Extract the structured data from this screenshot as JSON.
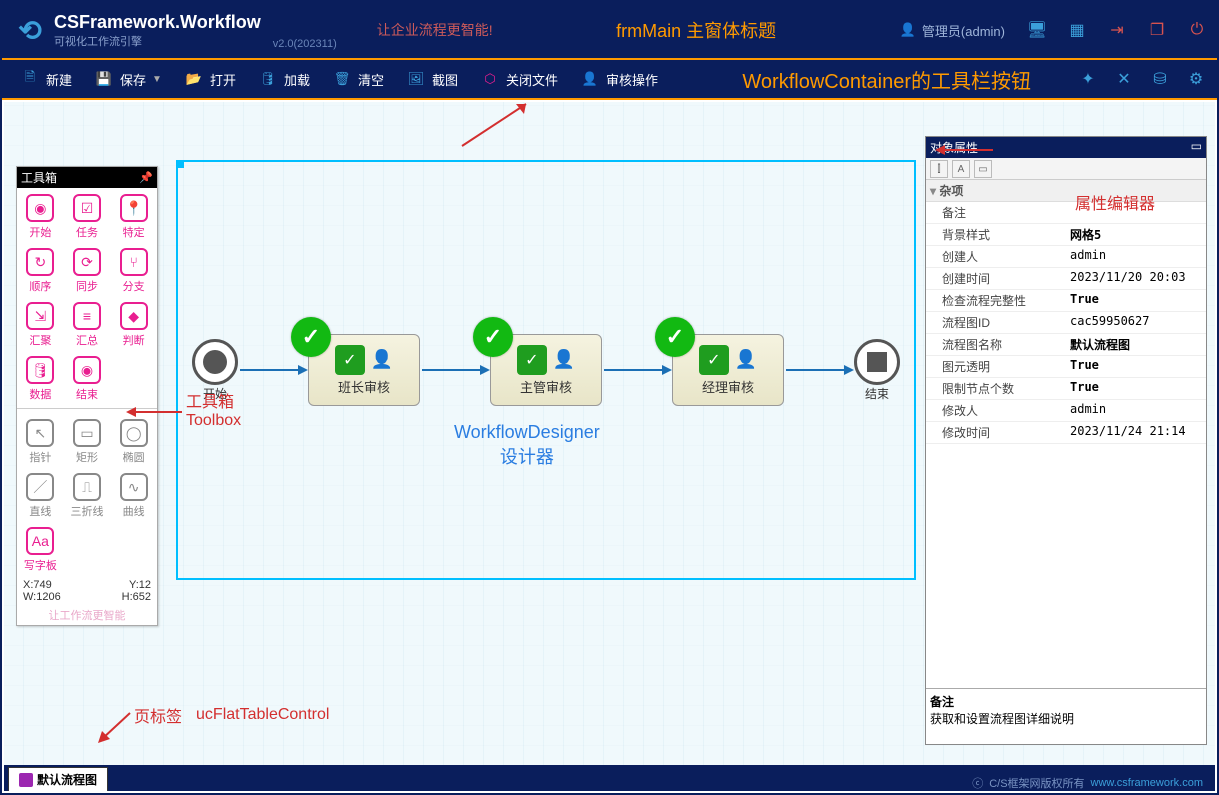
{
  "header": {
    "app_title": "CSFramework.Workflow",
    "app_subtitle": "可视化工作流引擎",
    "version": "v2.0(202311)",
    "slogan": "让企业流程更智能!",
    "window_title": "frmMain 主窗体标题",
    "user_label": "管理员(admin)"
  },
  "toolbar": {
    "new": "新建",
    "save": "保存",
    "open": "打开",
    "load": "加载",
    "clear": "清空",
    "screenshot": "截图",
    "close_file": "关闭文件",
    "audit": "审核操作",
    "caption": "WorkflowContainer的工具栏按钮"
  },
  "toolbox": {
    "title": "工具箱",
    "items_main": [
      {
        "label": "开始"
      },
      {
        "label": "任务"
      },
      {
        "label": "特定"
      },
      {
        "label": "顺序"
      },
      {
        "label": "同步"
      },
      {
        "label": "分支"
      },
      {
        "label": "汇聚"
      },
      {
        "label": "汇总"
      },
      {
        "label": "判断"
      },
      {
        "label": "数据"
      },
      {
        "label": "结束"
      }
    ],
    "items_shapes": [
      {
        "label": "指针",
        "gray": true
      },
      {
        "label": "矩形",
        "gray": true
      },
      {
        "label": "椭圆",
        "gray": true
      },
      {
        "label": "直线",
        "gray": true
      },
      {
        "label": "三折线",
        "gray": true
      },
      {
        "label": "曲线",
        "gray": true
      },
      {
        "label": "写字板"
      }
    ],
    "coords": {
      "x": "X:749",
      "y": "Y:12",
      "w": "W:1206",
      "h": "H:652"
    },
    "motto": "让工作流更智能",
    "anno_line1": "工具箱",
    "anno_line2": "Toolbox"
  },
  "workflow_nodes": {
    "start": "开始",
    "n1": "班长审核",
    "n2": "主管审核",
    "n3": "经理审核",
    "end": "结束",
    "designer_label1": "WorkflowDesigner",
    "designer_label2": "设计器"
  },
  "properties": {
    "title": "对象属性",
    "category": "杂项",
    "anno": "属性编辑器",
    "rows": [
      {
        "k": "备注",
        "v": ""
      },
      {
        "k": "背景样式",
        "v": "网格5",
        "bold": true
      },
      {
        "k": "创建人",
        "v": "admin"
      },
      {
        "k": "创建时间",
        "v": "2023/11/20 20:03"
      },
      {
        "k": "检查流程完整性",
        "v": "True",
        "bold": true
      },
      {
        "k": "流程图ID",
        "v": "cac59950627"
      },
      {
        "k": "流程图名称",
        "v": "默认流程图",
        "bold": true
      },
      {
        "k": "图元透明",
        "v": "True",
        "bold": true
      },
      {
        "k": "限制节点个数",
        "v": "True",
        "bold": true
      },
      {
        "k": "修改人",
        "v": "admin"
      },
      {
        "k": "修改时间",
        "v": "2023/11/24 21:14"
      }
    ],
    "footer_title": "备注",
    "footer_text": "获取和设置流程图详细说明"
  },
  "tab": {
    "label": "默认流程图"
  },
  "bottom_anno": {
    "a": "页标签",
    "b": "ucFlatTableControl"
  },
  "status": {
    "copyright": "C/S框架网版权所有",
    "url": "www.csframework.com"
  }
}
